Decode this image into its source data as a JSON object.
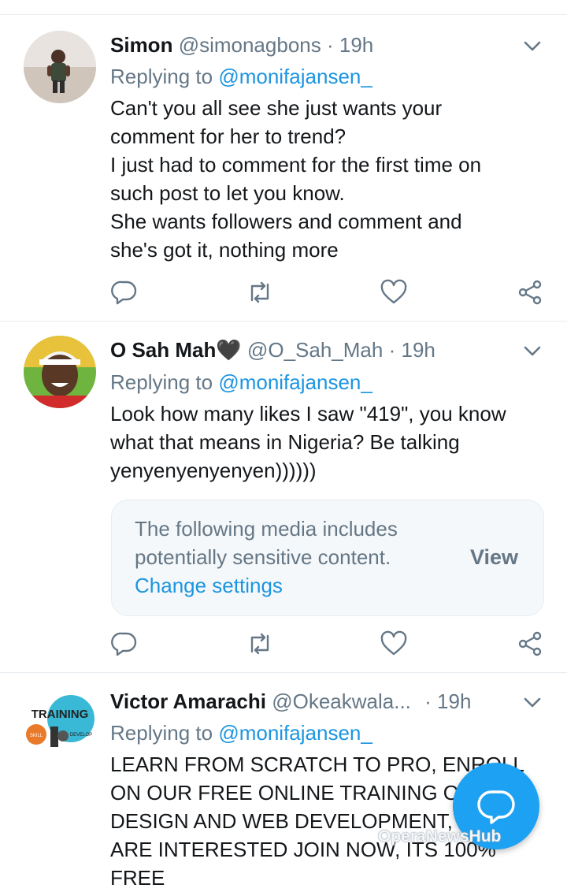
{
  "tweets": [
    {
      "name": "Simon",
      "handle": "@simonagbons",
      "separator": "·",
      "time": "19h",
      "replying_prefix": "Replying to ",
      "replying_to": "@monifajansen_",
      "lines": [
        "Can't you all see she just wants your",
        "comment for her to trend?",
        "I just had to comment for the first time on",
        "such post to let you know.",
        "She wants followers and comment and",
        "she's got it, nothing more"
      ]
    },
    {
      "name": "O Sah Mah",
      "name_emoji": "🖤",
      "handle": "@O_Sah_Mah",
      "separator": "·",
      "time": "19h",
      "replying_prefix": "Replying to ",
      "replying_to": "@monifajansen_",
      "lines": [
        "Look how many likes I saw \"419\", you know",
        "what that means in Nigeria?  Be talking",
        "yenyenyenyenyen))))))"
      ],
      "sensitive_notice": {
        "line1": "The following media includes",
        "line2": "potentially sensitive content.",
        "link": "Change settings",
        "view": "View"
      }
    },
    {
      "name": "Victor Amarachi",
      "handle": "@Okeakwala...",
      "separator": "·",
      "time": "19h",
      "replying_prefix": "Replying to ",
      "replying_to": "@monifajansen_",
      "avatar_text": {
        "title": "TRAINING",
        "left": "SKILL",
        "right": "DEVELOP"
      },
      "lines": [
        "LEARN FROM SCRATCH TO PRO, ENROLL",
        "ON OUR FREE ONLINE TRAINING OF",
        "DESIGN AND WEB DEVELOPMENT, IF YOU",
        "ARE INTERESTED JOIN NOW, ITS 100%",
        "FREE"
      ]
    }
  ],
  "action_icons": [
    "reply-icon",
    "retweet-icon",
    "like-icon",
    "share-icon"
  ],
  "fab_icon": "compose-reply-icon",
  "watermark": "OperaNewsHub",
  "colors": {
    "link": "#1b95e0",
    "muted": "#657786",
    "fab": "#1da1f2",
    "divider": "#e6ecf0"
  }
}
